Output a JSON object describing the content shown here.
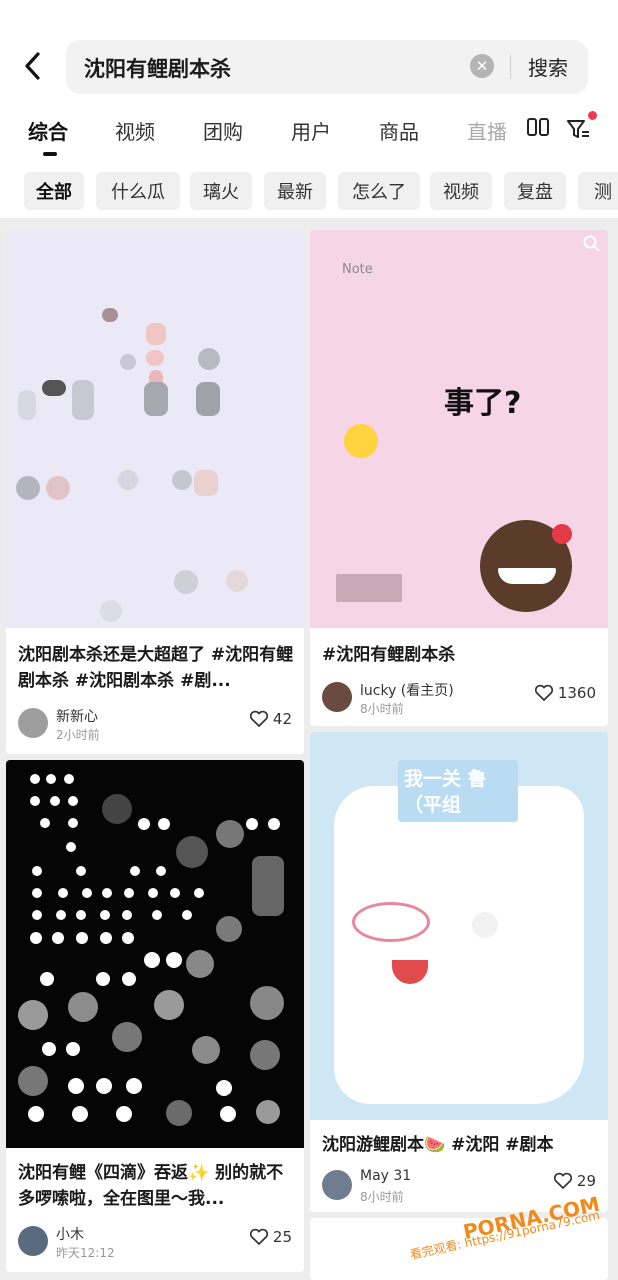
{
  "search": {
    "query": "沈阳有鲤剧本杀",
    "submit_label": "搜索"
  },
  "tabs": [
    {
      "label": "综合"
    },
    {
      "label": "视频"
    },
    {
      "label": "团购"
    },
    {
      "label": "用户"
    },
    {
      "label": "商品"
    },
    {
      "label": "直播"
    }
  ],
  "chips": [
    {
      "label": "全部"
    },
    {
      "label": "什么瓜"
    },
    {
      "label": "璃火"
    },
    {
      "label": "最新"
    },
    {
      "label": "怎么了"
    },
    {
      "label": "视频"
    },
    {
      "label": "复盘"
    },
    {
      "label": "测"
    }
  ],
  "cards": [
    {
      "title": "沈阳剧本杀还是大超超了 #沈阳有鲤剧本杀 #沈阳剧本杀 #剧...",
      "author": "新新心",
      "time": "2小时前",
      "likes": "42",
      "cover_color": "#ebe9f6"
    },
    {
      "title": "#沈阳有鲤剧本杀",
      "author": "lucky (看主页)",
      "time": "8小时前",
      "likes": "1360",
      "cover_note": "Note",
      "cover_headline": "事了?",
      "cover_color": "#f6d5e7"
    },
    {
      "title": "沈阳有鲤《四滴》吞返✨ 别的就不多啰嗦啦，全在图里～我...",
      "author": "小木",
      "time": "昨天12:12",
      "likes": "25",
      "cover_color": "#050505"
    },
    {
      "title": "沈阳游鲤剧本🍉 #沈阳 #剧本",
      "author": "May 31",
      "time": "8小时前",
      "likes": "29",
      "cover_banner": "我一关 鲁（平组",
      "cover_color": "#cfe6f5"
    }
  ],
  "watermark": {
    "brand": "PORNA.COM",
    "url": "看完观看: https://91porna79.com"
  },
  "icons": [
    "back-chevron-icon",
    "clear-icon",
    "grid-icon",
    "filter-icon",
    "heart-icon"
  ],
  "colors": {
    "accent_red": "#ef3b4f",
    "watermark_orange": "#f28a1b"
  }
}
